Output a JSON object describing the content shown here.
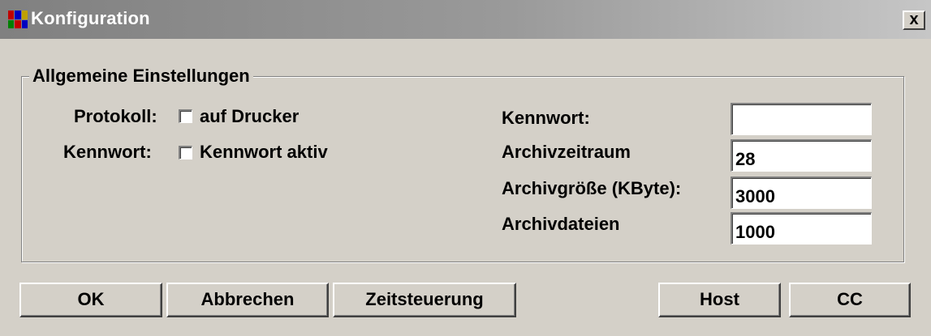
{
  "window": {
    "title": "Konfiguration",
    "close_glyph": "x",
    "app_icon": "multicolor-grid-icon"
  },
  "group": {
    "legend": "Allgemeine Einstellungen"
  },
  "left": {
    "protokoll_label": "Protokoll:",
    "protokoll_checkbox_label": "auf Drucker",
    "protokoll_checked": false,
    "kennwort_label": "Kennwort:",
    "kennwort_checkbox_label": "Kennwort aktiv",
    "kennwort_checked": false
  },
  "right": {
    "kennwort_label": "Kennwort:",
    "kennwort_value": "",
    "archivzeitraum_label": "Archivzeitraum",
    "archivzeitraum_value": "28",
    "archivgroesse_label": "Archivgröße (KByte):",
    "archivgroesse_value": "3000",
    "archivdateien_label": "Archivdateien",
    "archivdateien_value": "1000"
  },
  "buttons": {
    "ok": "OK",
    "abbrechen": "Abbrechen",
    "zeitsteuerung": "Zeitsteuerung",
    "host": "Host",
    "cc": "CC"
  },
  "colors": {
    "dialog_bg": "#d4d0c8",
    "titlebar_inactive": "#808080"
  }
}
